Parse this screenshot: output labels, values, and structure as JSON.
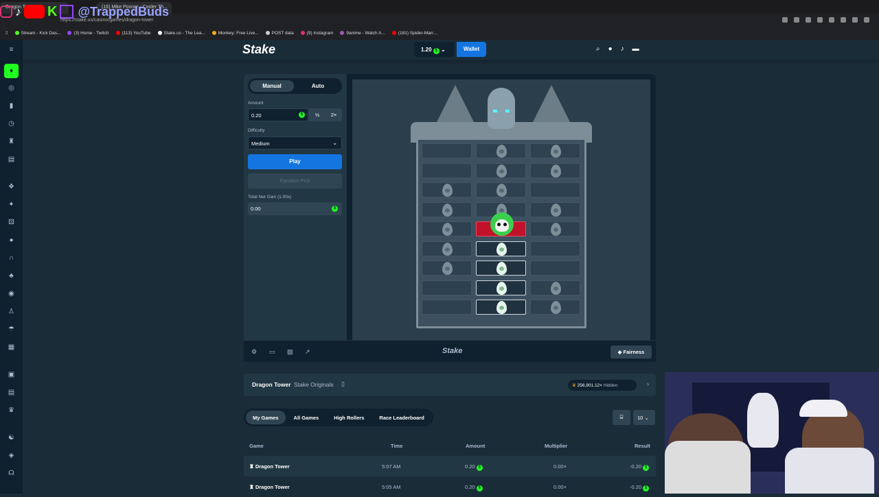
{
  "browser": {
    "tabs": [
      "Dragon Tower",
      "(16) Mike Posner - Cooler Th..."
    ],
    "url": "https://stake.us/casino/games/dragon-tower",
    "bookmarks": [
      {
        "label": "Stream - Kick Das...",
        "color": "#53fc18"
      },
      {
        "label": "(3) Home - Twitch",
        "color": "#9146ff"
      },
      {
        "label": "(113) YouTube",
        "color": "#ff0000"
      },
      {
        "label": "Stake.us - The Lea...",
        "color": "#ffffff"
      },
      {
        "label": "Monkey: Free Live...",
        "color": "#f5a623"
      },
      {
        "label": "POST data",
        "color": "#cccccc"
      },
      {
        "label": "(9) Instagram",
        "color": "#e1306c"
      },
      {
        "label": "9anime - Watch A...",
        "color": "#9b59b6"
      },
      {
        "label": "(181) Spider-Man:...",
        "color": "#ff0000"
      }
    ],
    "overlay_handle": "@TrappedBuds"
  },
  "header": {
    "logo": "Stake",
    "balance": "1.20",
    "wallet_label": "Wallet"
  },
  "controls": {
    "mode_manual": "Manual",
    "mode_auto": "Auto",
    "amount_label": "Amount",
    "amount_value": "0.20",
    "half_label": "½",
    "double_label": "2×",
    "difficulty_label": "Difficulty",
    "difficulty_value": "Medium",
    "play_label": "Play",
    "random_label": "Random Pick",
    "gain_label": "Total Net Gain (1.00x)",
    "gain_value": "0.00"
  },
  "board": {
    "rows": [
      [
        "empty",
        "egg",
        "egg"
      ],
      [
        "empty",
        "egg",
        "egg"
      ],
      [
        "egg",
        "egg",
        "empty"
      ],
      [
        "egg",
        "egg",
        "egg"
      ],
      [
        "egg",
        "bomb",
        "egg"
      ],
      [
        "egg",
        "picked",
        "empty"
      ],
      [
        "egg",
        "picked",
        "empty"
      ],
      [
        "empty",
        "picked",
        "egg"
      ],
      [
        "empty",
        "picked",
        "egg"
      ]
    ]
  },
  "footer": {
    "logo": "Stake",
    "fairness_label": "Fairness"
  },
  "info": {
    "game_name": "Dragon Tower",
    "game_sub": "Stake Originals",
    "max_win": "256,901.12×",
    "max_win_status": "Hidden"
  },
  "bets": {
    "tabs": [
      "My Games",
      "All Games",
      "High Rollers",
      "Race Leaderboard"
    ],
    "count": "10",
    "columns": [
      "Game",
      "Time",
      "Amount",
      "Multiplier",
      "Result"
    ],
    "rows": [
      {
        "game": "Dragon Tower",
        "time": "5:07 AM",
        "amount": "0.20",
        "multiplier": "0.00×",
        "result": "-0.20"
      },
      {
        "game": "Dragon Tower",
        "time": "5:05 AM",
        "amount": "0.20",
        "multiplier": "0.00×",
        "result": "-0.20"
      }
    ]
  }
}
